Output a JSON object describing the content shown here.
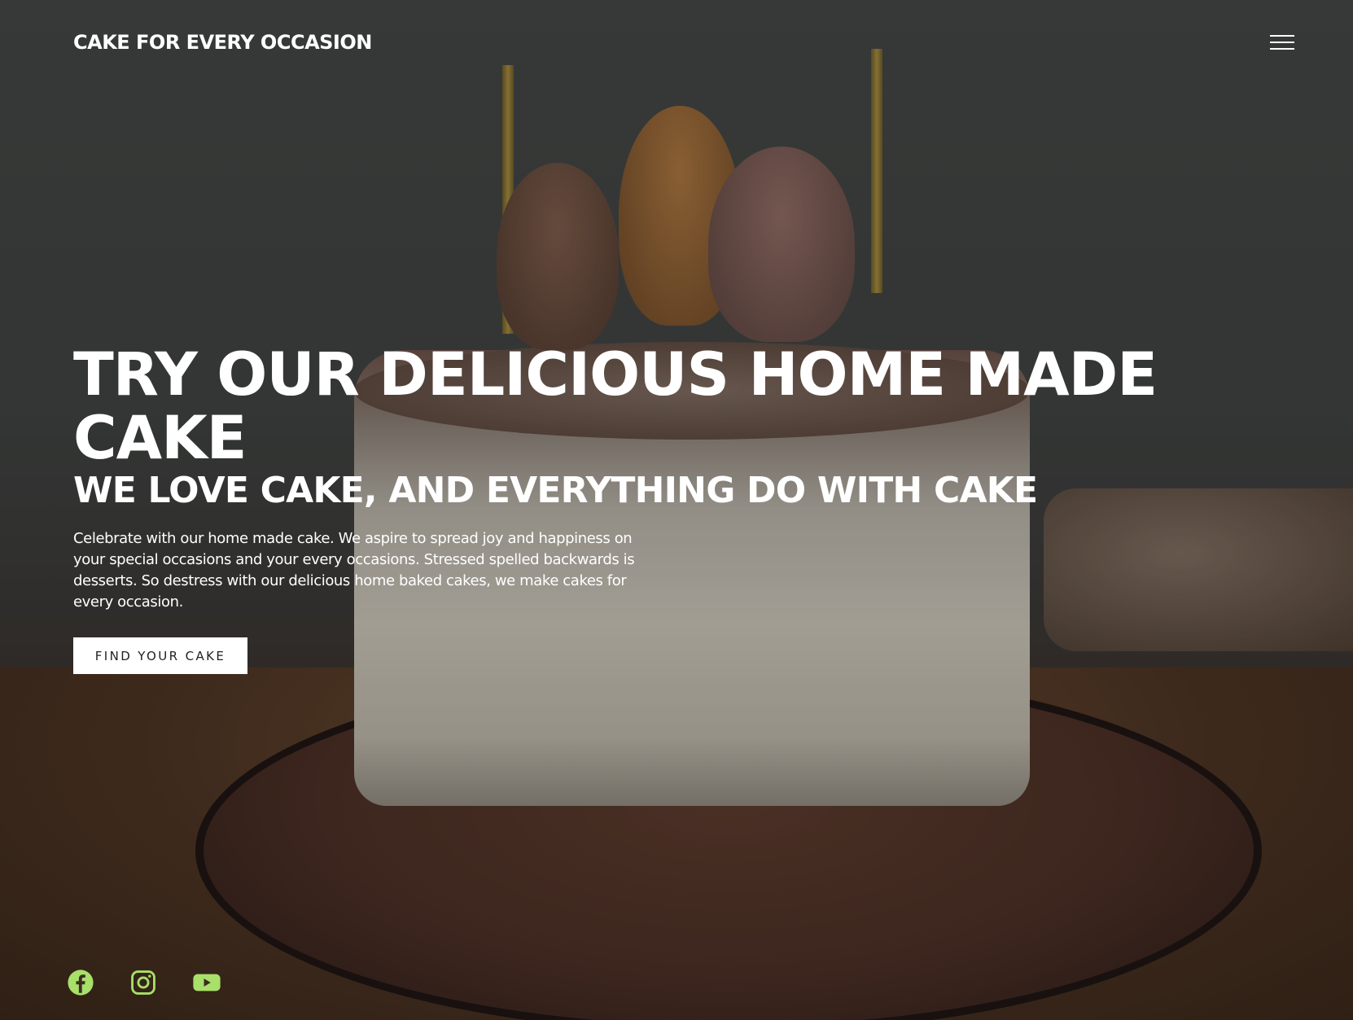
{
  "header": {
    "brand": "CAKE FOR EVERY OCCASION",
    "menu_icon": "hamburger-menu-icon"
  },
  "hero": {
    "title": "TRY OUR DELICIOUS HOME MADE CAKE",
    "subtitle": "WE LOVE CAKE, AND EVERYTHING DO WITH CAKE",
    "text": "Celebrate with our home made cake. We aspire to spread joy and happiness on your special occasions and your every occasions. Stressed spelled backwards is desserts. So destress with our delicious home baked cakes, we make cakes for every occasion.",
    "cta_label": "FIND YOUR CAKE"
  },
  "social": {
    "icons": [
      "facebook-icon",
      "instagram-icon",
      "youtube-icon"
    ],
    "icon_color": "#a8e06a"
  },
  "colors": {
    "accent": "#a8e06a",
    "button_bg": "#ffffff",
    "button_text": "#222222",
    "text": "#ffffff"
  }
}
